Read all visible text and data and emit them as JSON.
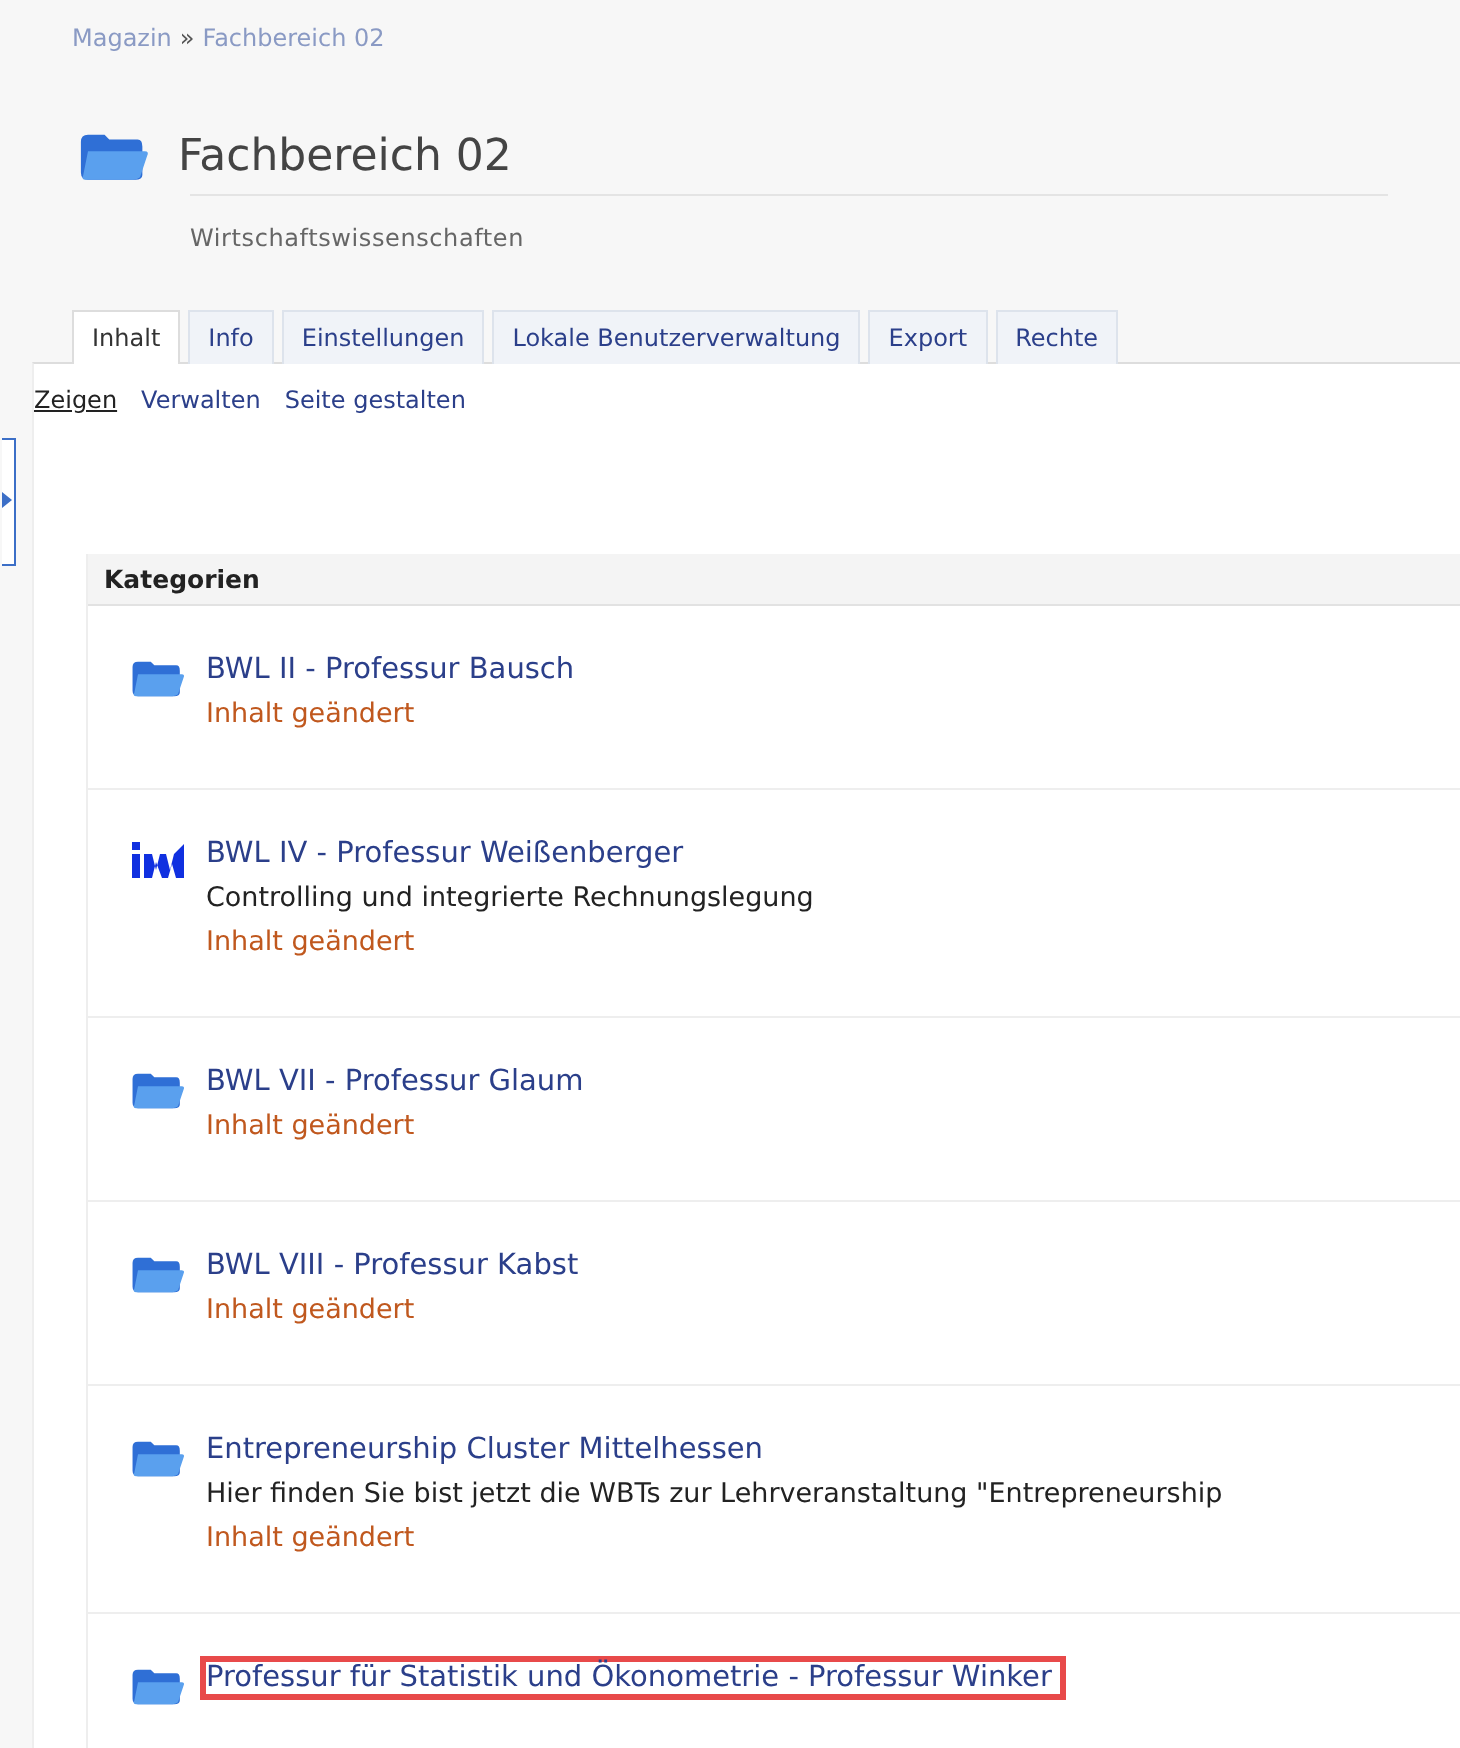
{
  "breadcrumb": [
    {
      "label": "Magazin"
    },
    {
      "separator": "»"
    },
    {
      "label": "Fachbereich 02"
    }
  ],
  "title": "Fachbereich 02",
  "subtitle": "Wirtschaftswissenschaften",
  "tabs": [
    {
      "label": "Inhalt",
      "selected": true
    },
    {
      "label": "Info",
      "selected": false
    },
    {
      "label": "Einstellungen",
      "selected": false
    },
    {
      "label": "Lokale Benutzerverwaltung",
      "selected": false
    },
    {
      "label": "Export",
      "selected": false
    },
    {
      "label": "Rechte",
      "selected": false
    }
  ],
  "subtabs": [
    {
      "label": "Zeigen",
      "selected": true
    },
    {
      "label": "Verwalten",
      "selected": false
    },
    {
      "label": "Seite gestalten",
      "selected": false
    }
  ],
  "categories": {
    "heading": "Kategorien",
    "items": [
      {
        "kind": "folder",
        "title": "BWL II - Professur Bausch",
        "status": "Inhalt geändert",
        "highlighted": false
      },
      {
        "kind": "logo",
        "title": "BWL IV - Professur Weißenberger",
        "description": "Controlling und integrierte Rechnungslegung",
        "status": "Inhalt geändert",
        "highlighted": false
      },
      {
        "kind": "folder",
        "title": "BWL VII - Professur Glaum",
        "status": "Inhalt geändert",
        "highlighted": false
      },
      {
        "kind": "folder",
        "title": "BWL VIII - Professur Kabst",
        "status": "Inhalt geändert",
        "highlighted": false
      },
      {
        "kind": "folder",
        "title": "Entrepreneurship Cluster Mittelhessen",
        "description": "Hier finden Sie bist jetzt die WBTs zur Lehrveranstaltung \"Entrepreneurship",
        "status": "Inhalt geändert",
        "highlighted": false
      },
      {
        "kind": "folder",
        "title": "Professur für Statistik und Ökonometrie - Professur Winker",
        "highlighted": true
      }
    ]
  }
}
